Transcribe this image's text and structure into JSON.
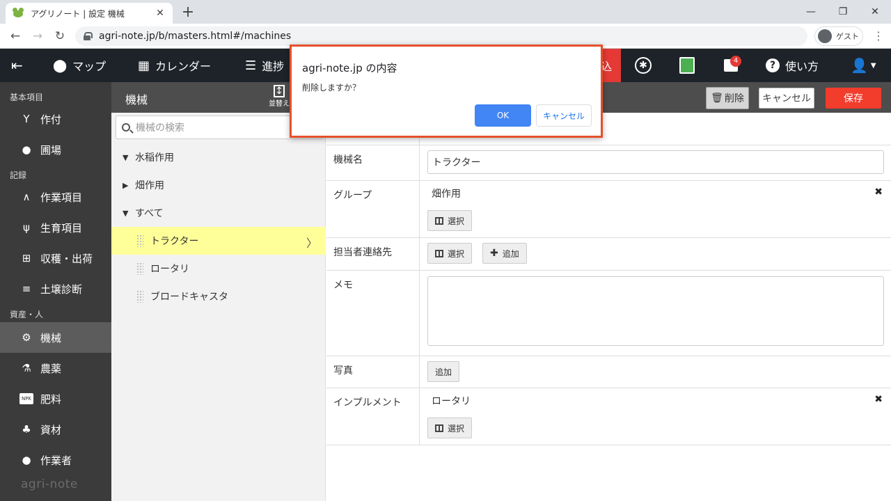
{
  "browser": {
    "tab_title": "アグリノート | 設定 機械",
    "url": "agri-note.jp/b/masters.html#/machines",
    "profile_label": "ゲスト"
  },
  "appbar": {
    "items": [
      {
        "label": "マップ",
        "icon": "map-pin-icon"
      },
      {
        "label": "カレンダー",
        "icon": "calendar-icon"
      },
      {
        "label": "進捗",
        "icon": "list-icon"
      },
      {
        "label": "使い方",
        "icon": "help-icon"
      }
    ],
    "red_label": "込",
    "notification_count": "4"
  },
  "sidebar": {
    "sections": [
      "基本項目",
      "記録",
      "資産・人"
    ],
    "items": [
      {
        "label": "作付",
        "icon": "sprout-icon"
      },
      {
        "label": "圃場",
        "icon": "location-icon"
      },
      {
        "label": "作業項目",
        "icon": "work-icon"
      },
      {
        "label": "生育項目",
        "icon": "growth-icon"
      },
      {
        "label": "収穫・出荷",
        "icon": "basket-icon"
      },
      {
        "label": "土壌診断",
        "icon": "sliders-icon"
      },
      {
        "label": "機械",
        "icon": "tractor-icon"
      },
      {
        "label": "農薬",
        "icon": "flask-icon"
      },
      {
        "label": "肥料",
        "icon": "npk-icon"
      },
      {
        "label": "資材",
        "icon": "material-icon"
      },
      {
        "label": "作業者",
        "icon": "person-icon"
      }
    ],
    "logo": "agri-note",
    "npk_text": "NPK"
  },
  "subbar": {
    "title": "機械",
    "sort_label": "並替え",
    "delete_label": "削除",
    "cancel_label": "キャンセル",
    "save_label": "保存"
  },
  "list": {
    "search_placeholder": "機械の検索",
    "groups": [
      "水稲作用",
      "畑作用",
      "すべて"
    ],
    "items": [
      "トラクター",
      "ロータリ",
      "ブロードキャスタ"
    ]
  },
  "form": {
    "name_label": "機械名",
    "name_value": "トラクター",
    "group_label": "グループ",
    "group_value": "畑作用",
    "contact_label": "担当者連絡先",
    "memo_label": "メモ",
    "photo_label": "写真",
    "implement_label": "インプルメント",
    "implement_value": "ロータリ",
    "select_label": "選択",
    "add_label": "追加"
  },
  "dialog": {
    "title": "agri-note.jp の内容",
    "message": "削除しますか？",
    "ok_label": "OK",
    "cancel_label": "キャンセル"
  },
  "colors": {
    "accent_red": "#f23c2c",
    "dialog_border": "#e5502c",
    "ok_blue": "#4285f4",
    "selected_row": "#ffff99"
  }
}
